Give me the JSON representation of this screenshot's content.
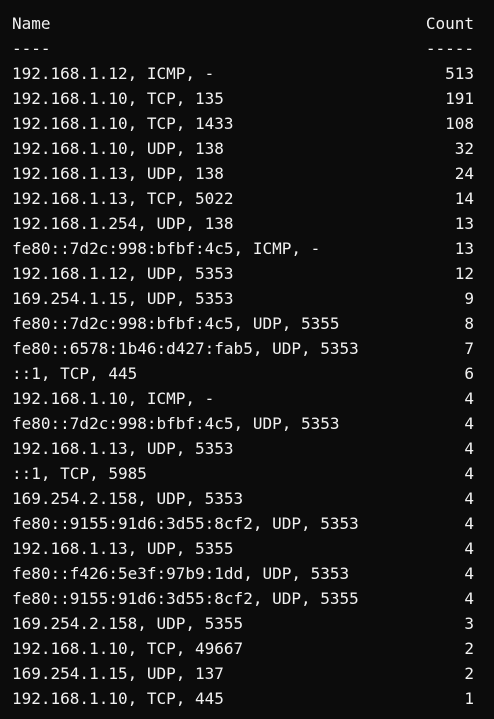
{
  "table": {
    "header": {
      "name": "Name",
      "count": "Count"
    },
    "separator": {
      "name": "----",
      "count": "-----"
    },
    "rows": [
      {
        "name": "192.168.1.12, ICMP, -",
        "count": "513"
      },
      {
        "name": "192.168.1.10, TCP, 135",
        "count": "191"
      },
      {
        "name": "192.168.1.10, TCP, 1433",
        "count": "108"
      },
      {
        "name": "192.168.1.10, UDP, 138",
        "count": "32"
      },
      {
        "name": "192.168.1.13, UDP, 138",
        "count": "24"
      },
      {
        "name": "192.168.1.13, TCP, 5022",
        "count": "14"
      },
      {
        "name": "192.168.1.254, UDP, 138",
        "count": "13"
      },
      {
        "name": "fe80::7d2c:998:bfbf:4c5, ICMP, -",
        "count": "13"
      },
      {
        "name": "192.168.1.12, UDP, 5353",
        "count": "12"
      },
      {
        "name": "169.254.1.15, UDP, 5353",
        "count": "9"
      },
      {
        "name": "fe80::7d2c:998:bfbf:4c5, UDP, 5355",
        "count": "8"
      },
      {
        "name": "fe80::6578:1b46:d427:fab5, UDP, 5353",
        "count": "7"
      },
      {
        "name": "::1, TCP, 445",
        "count": "6"
      },
      {
        "name": "192.168.1.10, ICMP, -",
        "count": "4"
      },
      {
        "name": "fe80::7d2c:998:bfbf:4c5, UDP, 5353",
        "count": "4"
      },
      {
        "name": "192.168.1.13, UDP, 5353",
        "count": "4"
      },
      {
        "name": "::1, TCP, 5985",
        "count": "4"
      },
      {
        "name": "169.254.2.158, UDP, 5353",
        "count": "4"
      },
      {
        "name": "fe80::9155:91d6:3d55:8cf2, UDP, 5353",
        "count": "4"
      },
      {
        "name": "192.168.1.13, UDP, 5355",
        "count": "4"
      },
      {
        "name": "fe80::f426:5e3f:97b9:1dd, UDP, 5353",
        "count": "4"
      },
      {
        "name": "fe80::9155:91d6:3d55:8cf2, UDP, 5355",
        "count": "4"
      },
      {
        "name": "169.254.2.158, UDP, 5355",
        "count": "3"
      },
      {
        "name": "192.168.1.10, TCP, 49667",
        "count": "2"
      },
      {
        "name": "169.254.1.15, UDP, 137",
        "count": "2"
      },
      {
        "name": "192.168.1.10, TCP, 445",
        "count": "1"
      }
    ]
  }
}
